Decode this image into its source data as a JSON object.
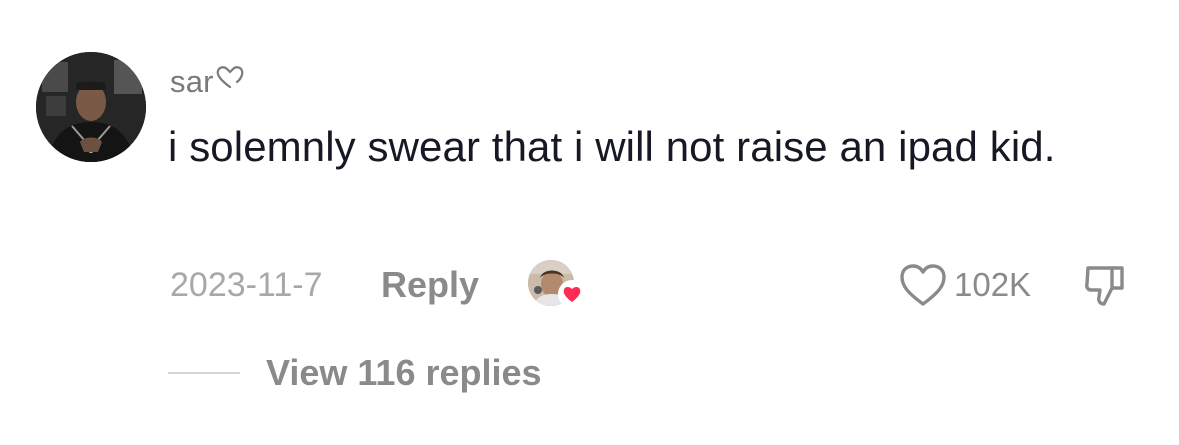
{
  "comment": {
    "username": "sar",
    "username_glyph": "heart-outline-icon",
    "text": "i solemnly swear that i will not raise an ipad kid.",
    "date": "2023-11-7",
    "reply_label": "Reply",
    "like_count": "102K",
    "creator_liked": true,
    "view_replies_label": "View 116 replies"
  },
  "colors": {
    "text_primary": "#161823",
    "text_secondary": "#8a8a8a",
    "date": "#a8a8a8",
    "heart_accent": "#fe2c55"
  },
  "icons": {
    "like": "heart-outline-icon",
    "dislike": "thumbs-down-icon",
    "creator_badge": "heart-filled-icon"
  }
}
